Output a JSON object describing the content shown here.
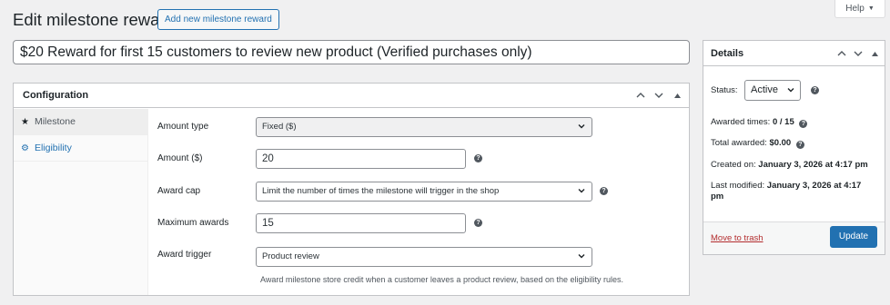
{
  "header": {
    "title": "Edit milestone reward",
    "add_new_label": "Add new milestone reward",
    "help_label": "Help"
  },
  "title_field": {
    "value": "$20 Reward for first 15 customers to review new product (Verified purchases only)"
  },
  "configuration": {
    "title": "Configuration",
    "tabs": [
      {
        "label": "Milestone",
        "icon": "star-icon"
      },
      {
        "label": "Eligibility",
        "icon": "gear-icon"
      }
    ],
    "fields": {
      "amount_type": {
        "label": "Amount type",
        "value": "Fixed ($)"
      },
      "amount": {
        "label": "Amount ($)",
        "value": "20"
      },
      "award_cap": {
        "label": "Award cap",
        "value": "Limit the number of times the milestone will trigger in the shop"
      },
      "maximum_awards": {
        "label": "Maximum awards",
        "value": "15"
      },
      "award_trigger": {
        "label": "Award trigger",
        "value": "Product review",
        "description": "Award milestone store credit when a customer leaves a product review, based on the eligibility rules."
      }
    }
  },
  "details": {
    "title": "Details",
    "status_label": "Status:",
    "status_value": "Active",
    "awarded_times_label": "Awarded times:",
    "awarded_times_value": "0 / 15",
    "total_awarded_label": "Total awarded:",
    "total_awarded_value": "$0.00",
    "created_label": "Created on:",
    "created_value": "January 3, 2026 at 4:17 pm",
    "modified_label": "Last modified:",
    "modified_value": "January 3, 2026 at 4:17",
    "modified_value_cont": "pm",
    "trash_label": "Move to trash",
    "update_label": "Update"
  },
  "colors": {
    "accent": "#2271b1",
    "danger": "#b32d2e",
    "background": "#f0f0f1"
  }
}
